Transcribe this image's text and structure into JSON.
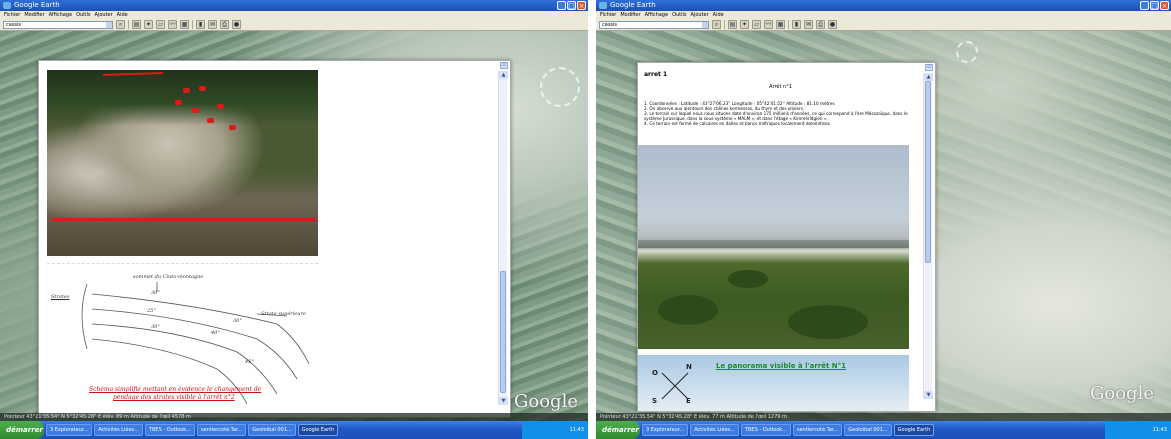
{
  "window1": {
    "title": "Google Earth",
    "menu": [
      "Fichier",
      "Modifier",
      "Affichage",
      "Outils",
      "Ajouter",
      "Aide"
    ],
    "search_value": "cassis",
    "sketch": {
      "top_label": "sommet du Cinto-montagne",
      "left_label": "Strates",
      "angles": [
        "30°",
        "25°",
        "30°",
        "30°",
        "40°",
        "45°"
      ],
      "right_label": "Strate supérieure",
      "caption_line1": "Schéma simplifié mettant en évidence le changement de",
      "caption_line2": "pendage des strates visible à l'arrêt n°2"
    },
    "status": "Pointeur  43°21'35.54\" N   5°32'45.28\" E   élév.  89 m            Altitude de l'œil   4578 m",
    "logo": "Google"
  },
  "window2": {
    "title": "Google Earth",
    "menu": [
      "Fichier",
      "Modifier",
      "Affichage",
      "Outils",
      "Ajouter",
      "Aide"
    ],
    "search_value": "cassis",
    "article": {
      "heading": "arret 1",
      "title": "Arrêt n°1",
      "lines": [
        "1. Coordonnées : Latitude : 43°27'06.23'' Longitude : 05°42'41.52'' Altitude : 81.10 mètres",
        "2. On observe aux alentours des chênes kermesses, du thym et des oliviers.",
        "3. Le terrain sur lequel nous nous situons date d'environ 175 millions d'années, ce qui correspond à l'ère Mésozoïque, dans le",
        "système Jurassique, dans la sous-système « MALM », et dans l'étage « Kimméridgien ».",
        "4. Ce terrain est formé de calcaires en dalles et bancs métriques localement dolomitises."
      ],
      "panorama_link": "Le panorama visible à l'arrêt N°1",
      "compass": [
        "N",
        "O",
        "S",
        "E"
      ]
    },
    "status": "Pointeur  43°21'35.54\" N   5°32'45.28\" E   élév.  77 m            Altitude de l'œil   1279 m",
    "logo": "Google"
  },
  "taskbar": {
    "start": "démarrer",
    "tasks": [
      "3 Explorateur...",
      "Activités Liées...",
      "TBES - Outlook...",
      "sentiercoté.Tar...",
      "Geoloibal 001...",
      "Google Earth"
    ],
    "clock": "11:43"
  }
}
